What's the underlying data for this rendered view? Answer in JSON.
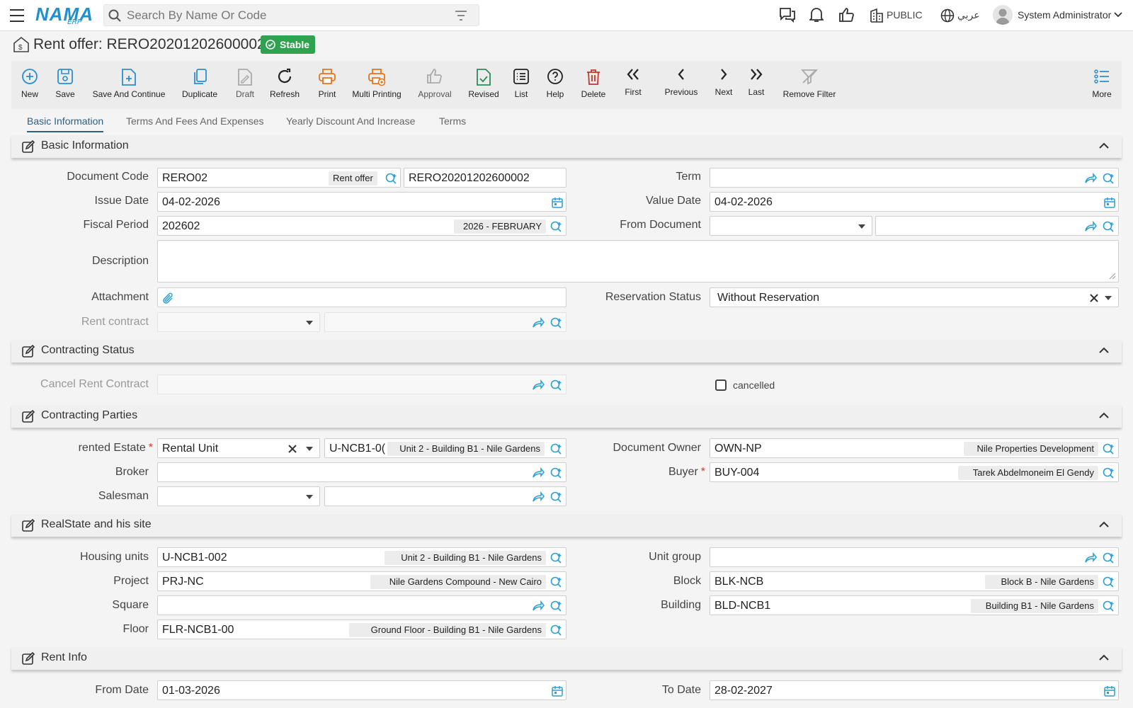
{
  "app": {
    "logo_main": "NAMA",
    "logo_sub": "ERP"
  },
  "search": {
    "placeholder": "Search By Name Or Code"
  },
  "header": {
    "public_label": "PUBLIC",
    "language_label": "عربي",
    "user_name": "System Administrator"
  },
  "page": {
    "title": "Rent offer: RERO20201202600002",
    "status_badge": "Stable"
  },
  "toolbar": [
    {
      "label": "New",
      "icon": "plus-circle-icon"
    },
    {
      "label": "Save",
      "icon": "save-icon"
    },
    {
      "label": "Save And Continue",
      "icon": "file-plus-icon"
    },
    {
      "label": "Duplicate",
      "icon": "copy-icon"
    },
    {
      "label": "Draft",
      "icon": "draft-icon"
    },
    {
      "label": "Refresh",
      "icon": "refresh-icon"
    },
    {
      "label": "Print",
      "icon": "print-icon"
    },
    {
      "label": "Multi Printing",
      "icon": "multi-print-icon"
    },
    {
      "label": "Approval",
      "icon": "thumbs-up-icon"
    },
    {
      "label": "Revised",
      "icon": "revised-icon"
    },
    {
      "label": "List",
      "icon": "list-icon"
    },
    {
      "label": "Help",
      "icon": "help-icon"
    },
    {
      "label": "Delete",
      "icon": "trash-icon"
    },
    {
      "label": "First",
      "icon": "first-icon"
    },
    {
      "label": "Previous",
      "icon": "previous-icon"
    },
    {
      "label": "Next",
      "icon": "next-icon"
    },
    {
      "label": "Last",
      "icon": "last-icon"
    },
    {
      "label": "Remove Filter",
      "icon": "remove-filter-icon"
    },
    {
      "label": "More",
      "icon": "more-icon"
    }
  ],
  "tabs": [
    {
      "label": "Basic Information",
      "active": true
    },
    {
      "label": "Terms And Fees And Expenses"
    },
    {
      "label": "Yearly Discount And Increase"
    },
    {
      "label": "Terms"
    }
  ],
  "sections": {
    "basic": "Basic Information",
    "contracting_status": "Contracting Status",
    "contracting_parties": "Contracting Parties",
    "realstate": "RealState and his site",
    "rent_info": "Rent Info"
  },
  "basic": {
    "document_code": {
      "label": "Document Code",
      "value": "RERO02",
      "tag": "Rent offer",
      "code": "RERO20201202600002"
    },
    "term": {
      "label": "Term",
      "value": ""
    },
    "issue_date": {
      "label": "Issue Date",
      "value": "04-02-2026"
    },
    "value_date": {
      "label": "Value Date",
      "value": "04-02-2026"
    },
    "fiscal_period": {
      "label": "Fiscal Period",
      "value": "202602",
      "desc": "2026 - FEBRUARY"
    },
    "from_document": {
      "label": "From Document",
      "value": ""
    },
    "description": {
      "label": "Description",
      "value": ""
    },
    "attachment": {
      "label": "Attachment"
    },
    "reservation_status": {
      "label": "Reservation Status",
      "value": "Without Reservation"
    },
    "rent_contract": {
      "label": "Rent contract",
      "value": ""
    }
  },
  "contracting_status": {
    "cancel_rent_contract": {
      "label": "Cancel Rent Contract",
      "value": ""
    },
    "cancelled": {
      "label": "cancelled",
      "checked": false
    }
  },
  "parties": {
    "rented_estate": {
      "label": "rented Estate",
      "required": "*",
      "type_value": "Rental Unit",
      "code": "U-NCB1-0(",
      "desc": "Unit 2 - Building B1 - Nile Gardens"
    },
    "document_owner": {
      "label": "Document Owner",
      "code": "OWN-NP",
      "desc": "Nile Properties Development"
    },
    "broker": {
      "label": "Broker",
      "value": ""
    },
    "buyer": {
      "label": "Buyer",
      "required": "*",
      "code": "BUY-004",
      "desc": "Tarek Abdelmoneim El Gendy"
    },
    "salesman": {
      "label": "Salesman",
      "value": ""
    }
  },
  "realstate": {
    "housing_units": {
      "label": "Housing units",
      "code": "U-NCB1-002",
      "desc": "Unit 2 - Building B1 - Nile Gardens"
    },
    "unit_group": {
      "label": "Unit group",
      "value": ""
    },
    "project": {
      "label": "Project",
      "code": "PRJ-NC",
      "desc": "Nile Gardens Compound - New Cairo"
    },
    "block": {
      "label": "Block",
      "code": "BLK-NCB",
      "desc": "Block B - Nile Gardens"
    },
    "square": {
      "label": "Square",
      "value": ""
    },
    "building": {
      "label": "Building",
      "code": "BLD-NCB1",
      "desc": "Building B1 - Nile Gardens"
    },
    "floor": {
      "label": "Floor",
      "code": "FLR-NCB1-00",
      "desc": "Ground Floor - Building B1 - Nile Gardens"
    }
  },
  "rent_info": {
    "from_date": {
      "label": "From Date",
      "value": "01-03-2026"
    },
    "to_date": {
      "label": "To Date",
      "value": "28-02-2027"
    }
  },
  "colors": {
    "accent": "#2a5f8a",
    "link": "#2a9fd6",
    "stable": "#2ea24f",
    "print": "#e8731b",
    "delete": "#c0392b",
    "revised": "#2e8b57"
  }
}
